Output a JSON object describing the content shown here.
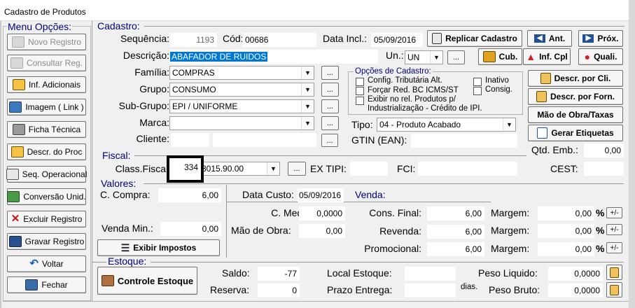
{
  "window": {
    "title": "Cadastro de Produtos"
  },
  "menu": {
    "title": "Menu Opções:",
    "items": [
      {
        "label": "Novo Registro"
      },
      {
        "label": "Consultar Reg."
      },
      {
        "label": "Inf. Adicionais"
      },
      {
        "label": "Imagem ( Link )"
      },
      {
        "label": "Ficha Técnica"
      },
      {
        "label": "Descr. do Proc"
      },
      {
        "label": "Seq. Operacional"
      },
      {
        "label": "Conversão Unid."
      },
      {
        "label": "Excluir Registro"
      },
      {
        "label": "Gravar Registro"
      },
      {
        "label": "Voltar"
      },
      {
        "label": "Fechar"
      }
    ]
  },
  "cadastro": {
    "title": "Cadastro:",
    "sequencia_label": "Sequência:",
    "sequencia": "1193",
    "cod_label": "Cód:",
    "cod": "00686",
    "data_incl_label": "Data Incl.:",
    "data_incl": "05/09/2016",
    "replicar": "Replicar Cadastro",
    "ant": "Ant.",
    "prox": "Próx.",
    "descricao_label": "Descrição:",
    "descricao": "ABAFADOR DE RUIDOS",
    "un_label": "Un.:",
    "un": "UN",
    "cub": "Cub.",
    "inf_cpl": "Inf. Cpl",
    "quali": "Quali.",
    "familia_label": "Família:",
    "familia": "COMPRAS",
    "grupo_label": "Grupo:",
    "grupo": "CONSUMO",
    "subgrupo_label": "Sub-Grupo:",
    "subgrupo": "EPI / UNIFORME",
    "marca_label": "Marca:",
    "marca": "",
    "cliente_label": "Cliente:",
    "tipo_label": "Tipo:",
    "tipo": "04 - Produto Acabado",
    "gtin_label": "GTIN (EAN):",
    "dots": "...",
    "opcoes": {
      "title": "Opções de Cadastro:",
      "config_trib": "Config. Tributária Alt.",
      "forcar": "Forçar Red. BC ICMS/ST",
      "exibir_1": "Exibir no rel. Produtos p/",
      "exibir_2": "Industrialização - Crédito de IPI.",
      "inativo": "Inativo",
      "consig": "Consig."
    },
    "descr_cli": "Descr. por Cli.",
    "descr_forn": "Descr. por Forn.",
    "mao_obra_taxas": "Mão de Obra/Taxas",
    "gerar_etiquetas": "Gerar Etiquetas",
    "qtd_emb_label": "Qtd. Emb.:",
    "qtd_emb": "0,00"
  },
  "fiscal": {
    "title": "Fiscal:",
    "class_label": "Class.Fiscal:",
    "class_code": "334",
    "class_ncm": "3015.90.00",
    "ex_tipi_label": "EX TIPI:",
    "fci_label": "FCI:",
    "cest_label": "CEST:"
  },
  "valores": {
    "title": "Valores:",
    "c_compra_label": "C. Compra:",
    "c_compra": "6,00",
    "venda_min_label": "Venda Min.:",
    "venda_min": "0,00",
    "exibir_impostos": "Exibir Impostos",
    "data_custo_label": "Data Custo:",
    "data_custo": "05/09/2016",
    "c_medio_label": "C. Medio:",
    "c_medio": "0,0000",
    "mao_obra_label": "Mão de Obra:",
    "mao_obra": "0,00",
    "venda_title": "Venda:",
    "rows": [
      {
        "label": "Cons. Final:",
        "value": "6,00",
        "margem_label": "Margem:",
        "margem": "0,00"
      },
      {
        "label": "Revenda:",
        "value": "6,00",
        "margem_label": "Margem:",
        "margem": "0,00"
      },
      {
        "label": "Promocional:",
        "value": "6,00",
        "margem_label": "Margem:",
        "margem": "0,00"
      }
    ],
    "pct": "%",
    "pm": "+/-"
  },
  "estoque": {
    "title": "Estoque:",
    "controle": "Controle Estoque",
    "saldo_label": "Saldo:",
    "saldo": "-77",
    "reserva_label": "Reserva:",
    "reserva": "0",
    "local_label": "Local Estoque:",
    "prazo_label": "Prazo Entrega:",
    "dias": "dias.",
    "peso_liq_label": "Peso Liquido:",
    "peso_liq": "0,0000",
    "peso_bruto_label": "Peso Bruto:",
    "peso_bruto": "0,0000"
  }
}
